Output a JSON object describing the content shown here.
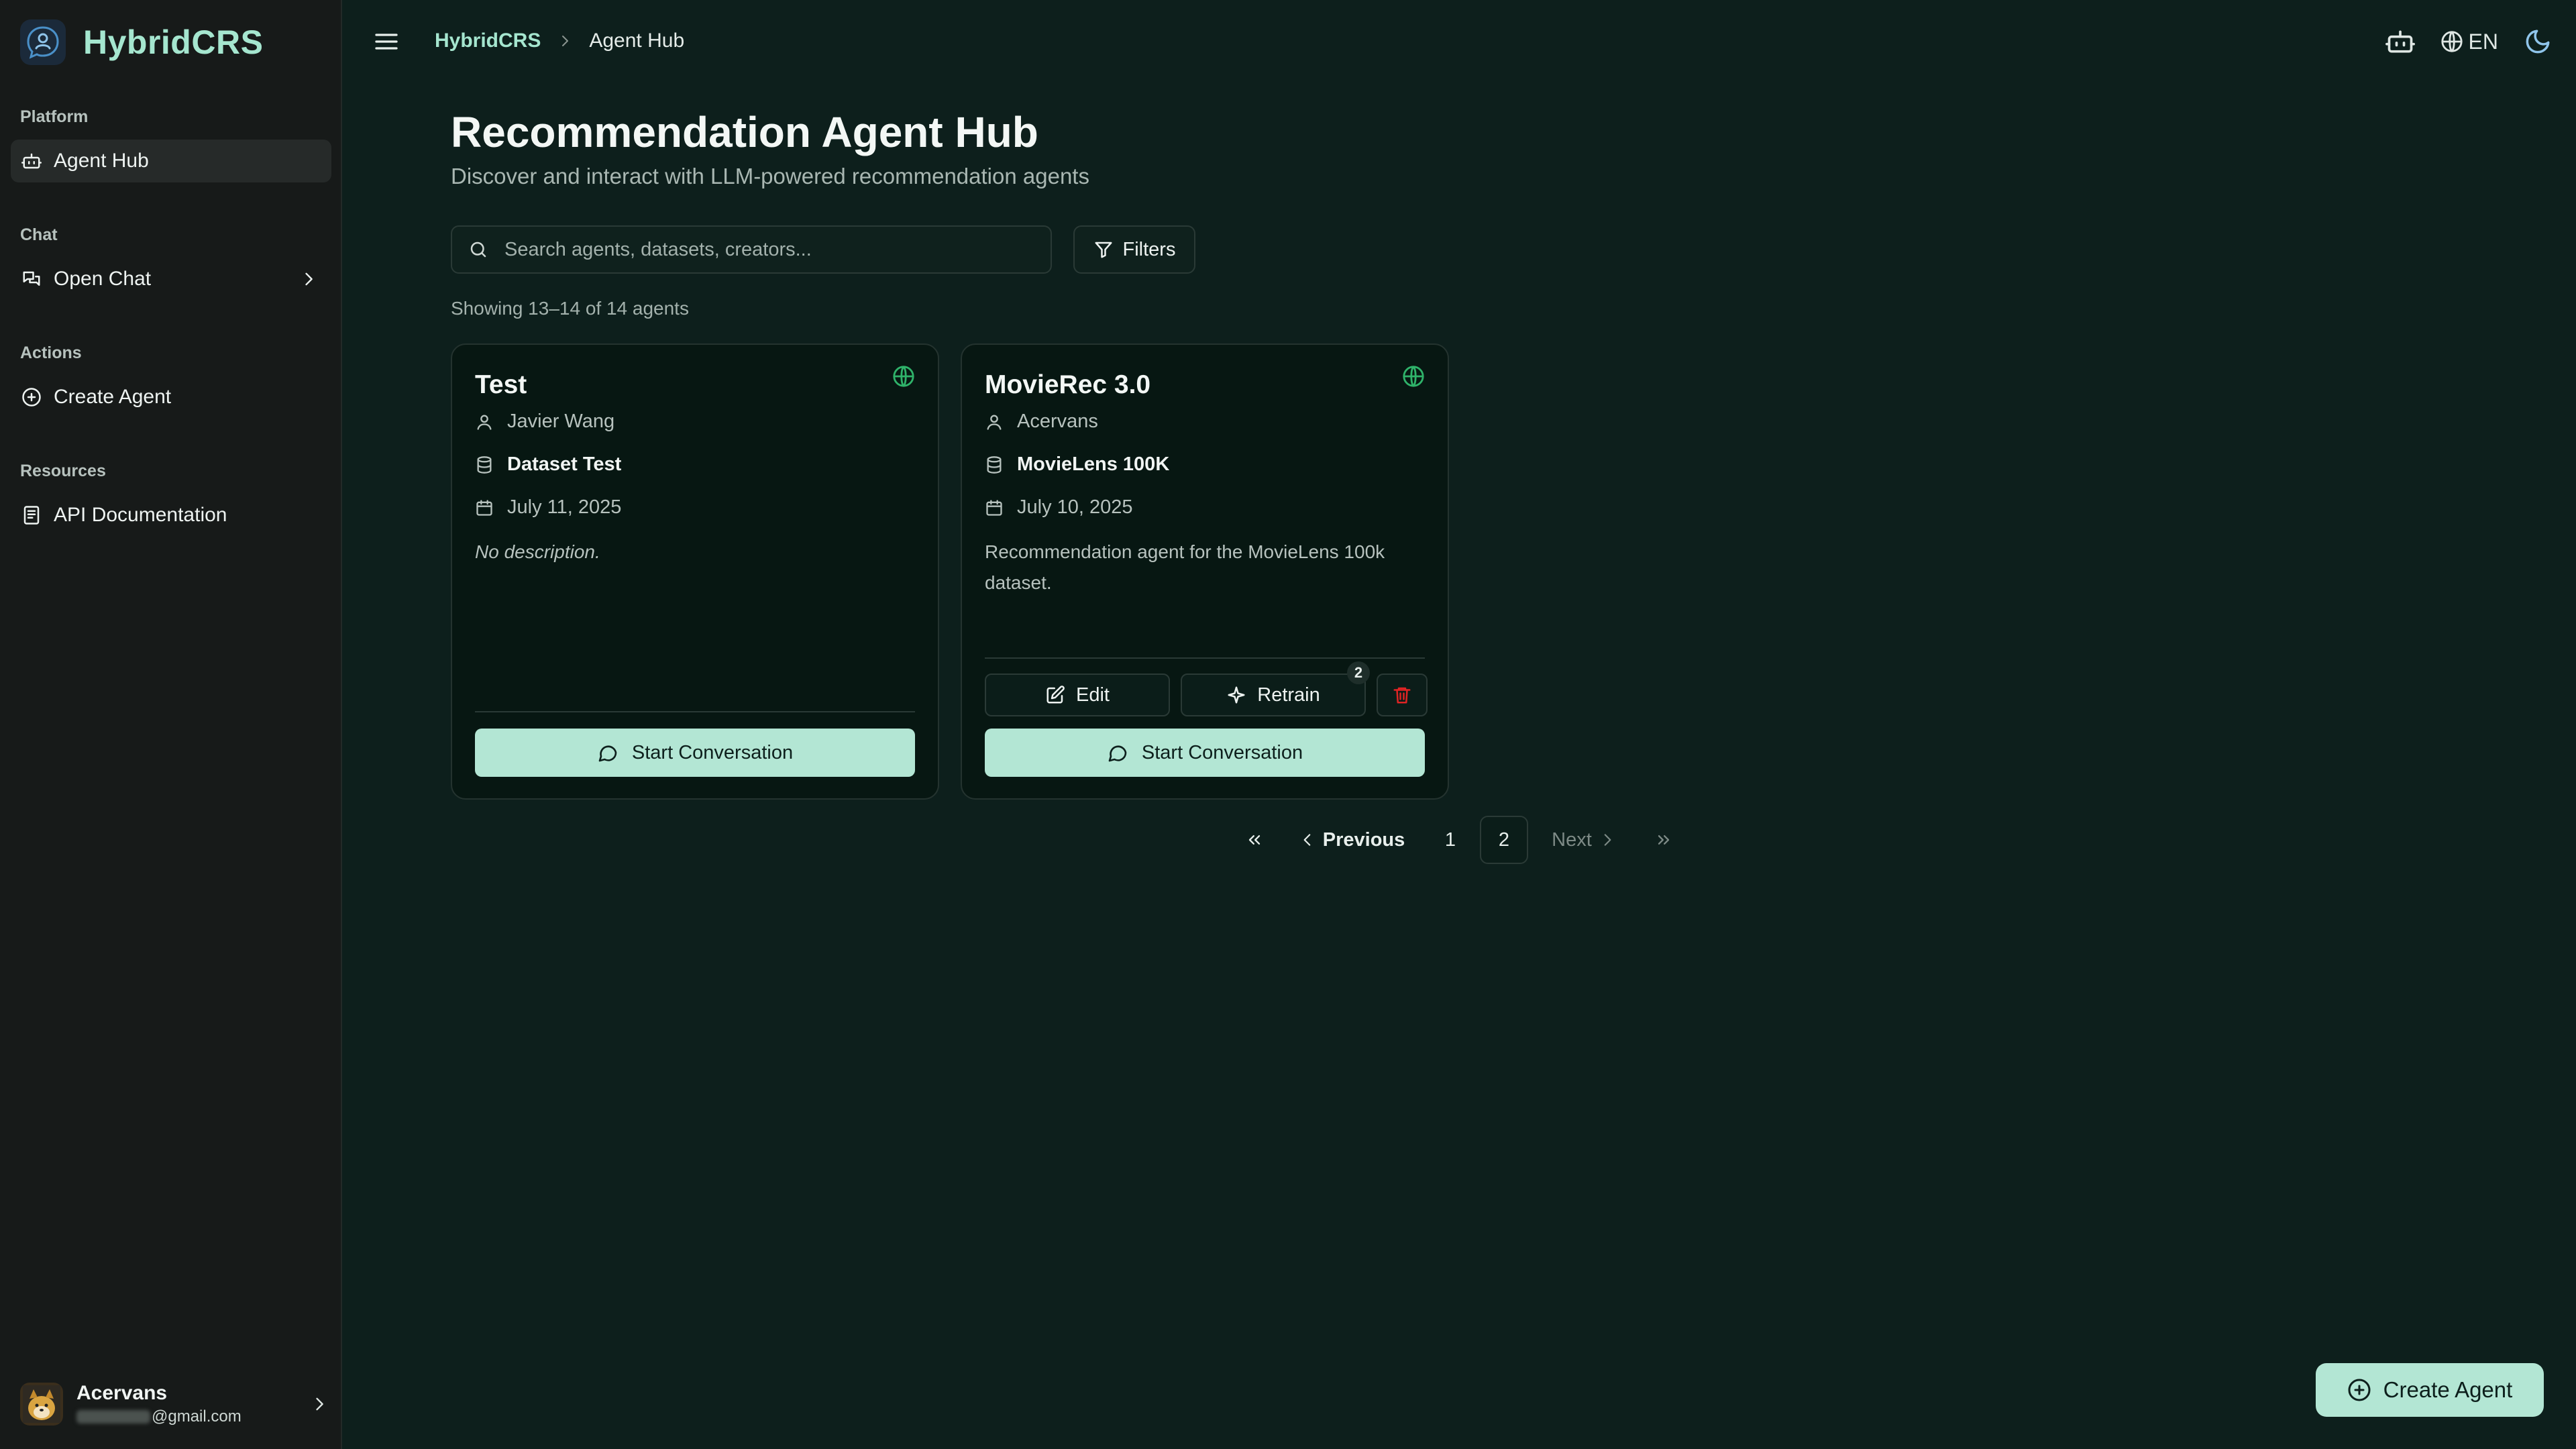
{
  "app": {
    "name": "HybridCRS"
  },
  "sidebar": {
    "sections": [
      {
        "label": "Platform",
        "items": [
          {
            "label": "Agent Hub",
            "icon": "bot-icon",
            "active": true
          }
        ]
      },
      {
        "label": "Chat",
        "items": [
          {
            "label": "Open Chat",
            "icon": "messages-icon",
            "has_submenu": true
          }
        ]
      },
      {
        "label": "Actions",
        "items": [
          {
            "label": "Create Agent",
            "icon": "plus-circle-icon"
          }
        ]
      },
      {
        "label": "Resources",
        "items": [
          {
            "label": "API Documentation",
            "icon": "document-icon"
          }
        ]
      }
    ],
    "user": {
      "name": "Acervans",
      "email_suffix": "@gmail.com"
    }
  },
  "header": {
    "breadcrumb": [
      "HybridCRS",
      "Agent Hub"
    ],
    "language": "EN"
  },
  "main": {
    "title": "Recommendation Agent Hub",
    "subtitle": "Discover and interact with LLM-powered recommendation agents",
    "search_placeholder": "Search agents, datasets, creators...",
    "filters_label": "Filters",
    "showing_text": "Showing 13–14 of 14 agents",
    "agents": [
      {
        "name": "Test",
        "creator": "Javier Wang",
        "dataset": "Dataset Test",
        "date": "July 11, 2025",
        "description": "No description.",
        "public": true,
        "start_label": "Start Conversation"
      },
      {
        "name": "MovieRec 3.0",
        "creator": "Acervans",
        "dataset": "MovieLens 100K",
        "date": "July 10, 2025",
        "description": "Recommendation agent for the MovieLens 100k dataset.",
        "public": true,
        "edit_label": "Edit",
        "retrain_label": "Retrain",
        "retrain_badge": "2",
        "start_label": "Start Conversation"
      }
    ],
    "pagination": {
      "previous_label": "Previous",
      "next_label": "Next",
      "pages": [
        "1",
        "2"
      ],
      "current": "2"
    },
    "fab_label": "Create Agent"
  },
  "colors": {
    "background": "#0d1f1c",
    "sidebar": "#171a19",
    "accent": "#a5e6cf",
    "button": "#b3e6d4",
    "public_icon": "#2fb36a",
    "delete_icon": "#e02424"
  }
}
